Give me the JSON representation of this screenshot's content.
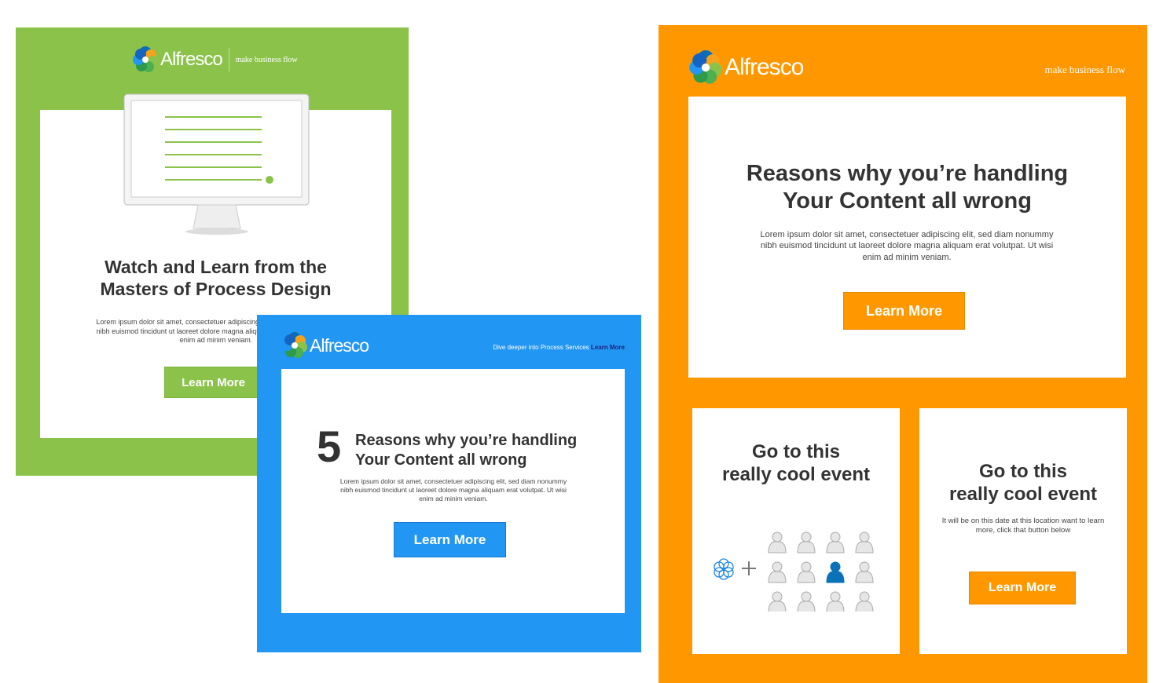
{
  "colors": {
    "green": "#8BC34A",
    "blue": "#2196F3",
    "orange": "#FF9800",
    "person_active": "#0A72B8",
    "person_idle": "#E6E6E6"
  },
  "green_email": {
    "brand": "Alfresco",
    "tagline": "make business flow",
    "title_line1": "Watch and Learn from the",
    "title_line2": "Masters of Process Design",
    "body": "Lorem ipsum dolor sit amet, consectetuer adipiscing elit, sed diam nonummy nibh euismod tincidunt ut laoreet dolore magna aliquam erat volutpat. Ut wisi enim ad minim veniam.",
    "button": "Learn More",
    "icon": "monitor-checklist-icon"
  },
  "blue_email": {
    "brand": "Alfresco",
    "header_text": "Dive deeper into Process Services",
    "header_link": "Learn More",
    "number": "5",
    "title_line1": "Reasons why you’re handling",
    "title_line2": "Your Content all wrong",
    "body": "Lorem ipsum dolor sit amet, consectetuer adipiscing elit, sed diam nonummy nibh euismod tincidunt ut laoreet dolore magna aliquam erat volutpat. Ut wisi enim ad minim veniam.",
    "button": "Learn More"
  },
  "orange_email": {
    "brand": "Alfresco",
    "tagline": "make business flow",
    "title_line1": "Reasons why you’re handling",
    "title_line2": "Your Content all wrong",
    "body": "Lorem ipsum dolor sit amet, consectetuer adipiscing elit, sed diam nonummy nibh euismod tincidunt ut laoreet dolore magna aliquam erat volutpat. Ut wisi enim ad minim veniam.",
    "button": "Learn More",
    "event1": {
      "title_line1": "Go to this",
      "title_line2": "really cool event",
      "icon": "people-grid-icon"
    },
    "event2": {
      "title_line1": "Go to this",
      "title_line2": "really cool event",
      "body": "It will be on this date at this location want to learn more, click that button below",
      "button": "Learn More"
    }
  }
}
